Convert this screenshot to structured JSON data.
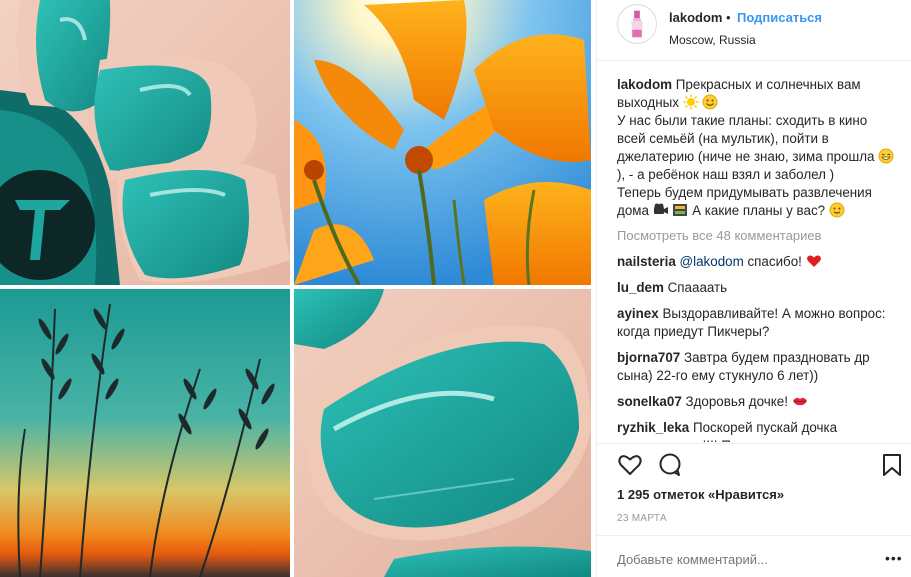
{
  "header": {
    "username": "lakodom",
    "separator": "•",
    "follow_label": "Подписаться",
    "location": "Moscow, Russia"
  },
  "caption": {
    "username": "lakodom",
    "line1": "Прекрасных и солнечных вам выходных",
    "line2": "У нас были такие планы: сходить в кино всей семьёй (на мультик), пойти в джелатерию (ниче не знаю, зима прошла",
    "line2b": "), - а ребёнок наш взял и заболел )",
    "line3": "Теперь будем придумывать развлечения дома",
    "line3b": "А какие планы у вас?"
  },
  "view_all": "Посмотреть все 48 комментариев",
  "comments": [
    {
      "user": "nailsteria",
      "mention": "@lakodom",
      "text": " спасибо!"
    },
    {
      "user": "lu_dem",
      "text": "Спаааать"
    },
    {
      "user": "ayinex",
      "text": "Выздоравливайте! А можно вопрос: когда приедут Пикчеры?"
    },
    {
      "user": "bjorna707",
      "text": "Завтра будем праздновать др сына) 22-го ему стукнуло 6 лет))"
    },
    {
      "user": "sonelka07",
      "text": "Здоровья дочке!"
    },
    {
      "user": "ryzhik_leka",
      "text": "Поскорей пускай дочка поправляется!!!! Полина, шикарная"
    }
  ],
  "likes": "1 295 отметок «Нравится»",
  "date": "23 МАРТА",
  "add_comment_placeholder": "Добавьте комментарий...",
  "more_label": "•••",
  "colors": {
    "link": "#3897f0",
    "teal": "#1ea6a0",
    "heart": "#ed4956"
  },
  "icons": {
    "like": "heart-outline-icon",
    "comment": "speech-bubble-icon",
    "save": "bookmark-icon"
  }
}
